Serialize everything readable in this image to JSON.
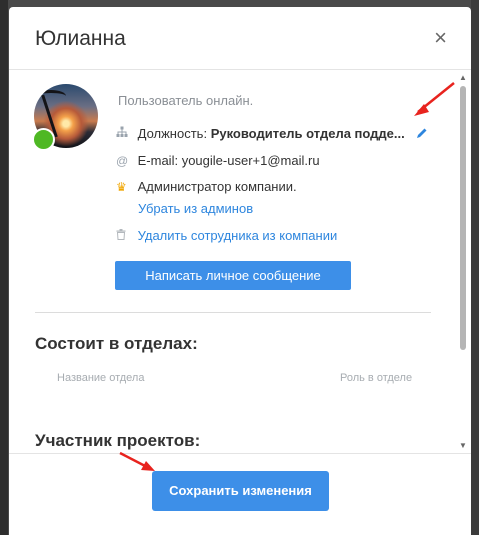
{
  "modal": {
    "title": "Юлианна",
    "close_icon": "×"
  },
  "profile": {
    "status": "Пользователь онлайн.",
    "position_label": "Должность:",
    "position_value": "Руководитель отдела подде...",
    "email_label": "E-mail:",
    "email_value": "yougile-user+1@mail.ru",
    "admin_text": "Администратор компании.",
    "remove_admin_link": "Убрать из админов",
    "delete_employee_link": "Удалить сотрудника из компании",
    "message_button": "Написать личное сообщение"
  },
  "departments": {
    "title": "Состоит в отделах:",
    "col_name": "Название отдела",
    "col_role": "Роль в отделе"
  },
  "projects": {
    "title": "Участник проектов:"
  },
  "footer": {
    "save_button": "Сохранить изменения"
  },
  "colors": {
    "accent": "#3d8fe8",
    "online": "#4fb824",
    "annotation_arrow": "#e8231e"
  },
  "icons": [
    "close-icon",
    "org-structure-icon",
    "at-icon",
    "crown-icon",
    "trash-icon",
    "pencil-icon"
  ]
}
